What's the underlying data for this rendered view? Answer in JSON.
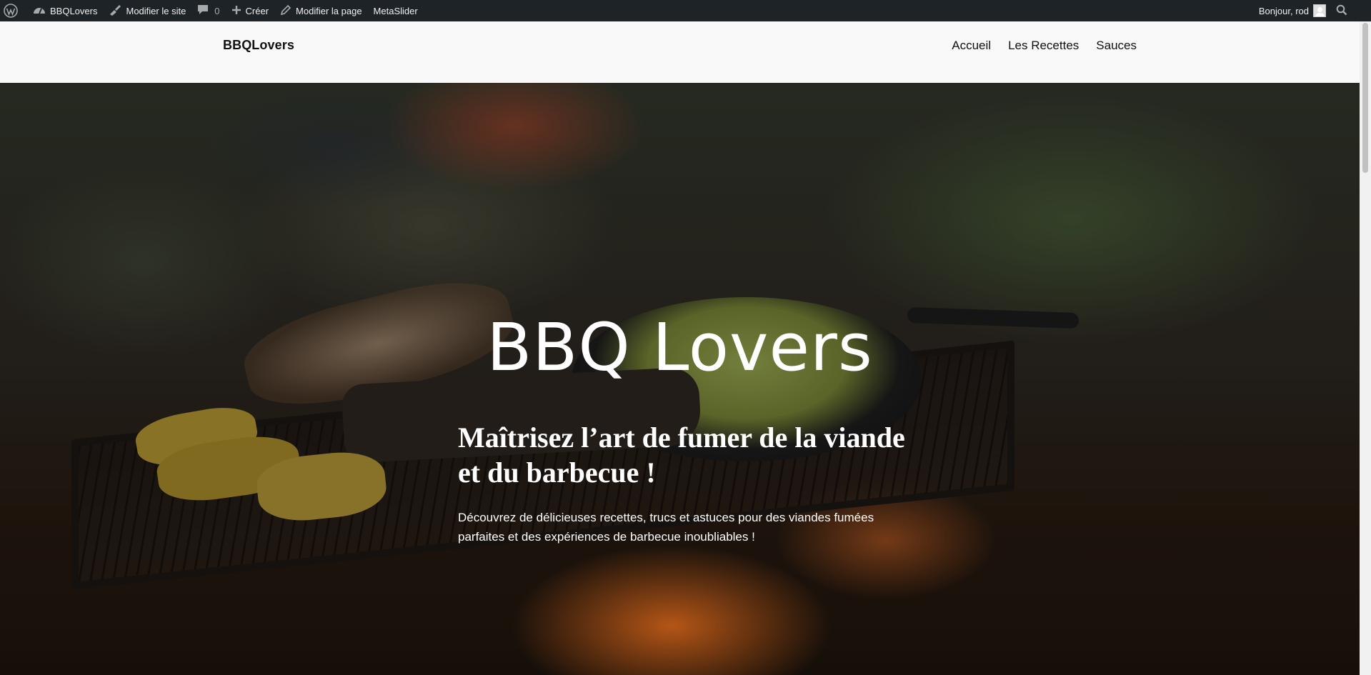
{
  "admin_bar": {
    "site_name": "BBQLovers",
    "customize_label": "Modifier le site",
    "comments_count": "0",
    "new_label": "Créer",
    "edit_page_label": "Modifier la page",
    "metaslider_label": "MetaSlider",
    "greeting": "Bonjour, rod"
  },
  "header": {
    "site_title": "BBQLovers",
    "nav": [
      "Accueil",
      "Les Recettes",
      "Sauces"
    ]
  },
  "hero": {
    "title": "BBQ Lovers",
    "subtitle": "Maîtrisez l’art de fumer de la viande et du barbecue !",
    "text": "Découvrez de délicieuses recettes, trucs et astuces pour des viandes fumées parfaites et des expériences de barbecue inoubliables !"
  },
  "icons": {
    "wp_logo": "wordpress-logo-icon",
    "dashboard": "gauge-icon",
    "customize": "brush-icon",
    "comments": "comment-bubble-icon",
    "new": "plus-icon",
    "edit": "pencil-icon",
    "search": "search-icon"
  },
  "colors": {
    "admin_bar_bg": "#1d2327",
    "header_bg": "#f9f9f9"
  }
}
